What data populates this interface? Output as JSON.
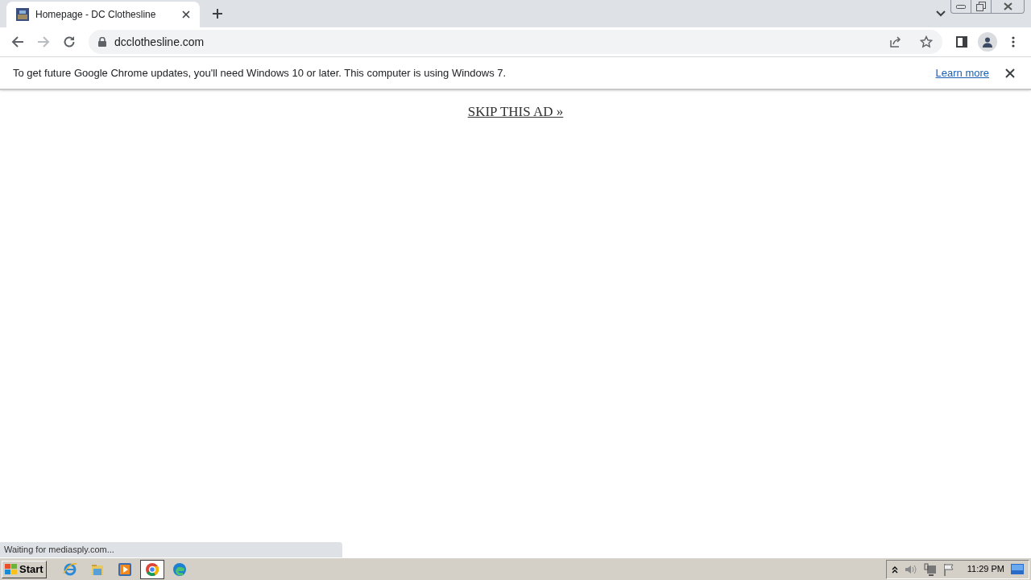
{
  "tabs": [
    {
      "title": "Homepage - DC Clothesline",
      "selected": true
    }
  ],
  "address_bar": {
    "url": "dcclothesline.com"
  },
  "infobar": {
    "message": "To get future Google Chrome updates, you'll need Windows 10 or later. This computer is using Windows 7.",
    "link": "Learn more"
  },
  "page": {
    "skip_link": "SKIP THIS AD »"
  },
  "status_bar": "Waiting for mediasply.com...",
  "taskbar": {
    "start": "Start",
    "apps": [
      {
        "kind": "ie",
        "selected": false
      },
      {
        "kind": "explorer",
        "selected": false
      },
      {
        "kind": "media",
        "selected": false
      },
      {
        "kind": "chrome",
        "selected": true
      },
      {
        "kind": "edge",
        "selected": false
      }
    ],
    "clock": "11:29 PM"
  }
}
